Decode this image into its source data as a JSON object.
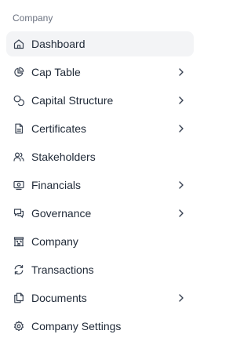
{
  "sidebar": {
    "section_label": "Company",
    "items": [
      {
        "label": "Dashboard",
        "icon": "home-icon",
        "active": true,
        "has_submenu": false
      },
      {
        "label": "Cap Table",
        "icon": "pie-chart-icon",
        "active": false,
        "has_submenu": true
      },
      {
        "label": "Capital Structure",
        "icon": "coins-icon",
        "active": false,
        "has_submenu": true
      },
      {
        "label": "Certificates",
        "icon": "certificate-icon",
        "active": false,
        "has_submenu": true
      },
      {
        "label": "Stakeholders",
        "icon": "users-icon",
        "active": false,
        "has_submenu": false
      },
      {
        "label": "Financials",
        "icon": "banknote-icon",
        "active": false,
        "has_submenu": true
      },
      {
        "label": "Governance",
        "icon": "chat-bubbles-icon",
        "active": false,
        "has_submenu": true
      },
      {
        "label": "Company",
        "icon": "building-icon",
        "active": false,
        "has_submenu": false
      },
      {
        "label": "Transactions",
        "icon": "refresh-icon",
        "active": false,
        "has_submenu": false
      },
      {
        "label": "Documents",
        "icon": "documents-icon",
        "active": false,
        "has_submenu": true
      },
      {
        "label": "Company Settings",
        "icon": "gear-icon",
        "active": false,
        "has_submenu": false
      }
    ]
  },
  "colors": {
    "active_background": "#f3f4f6",
    "text": "#1f2937",
    "muted_text": "#6b7280",
    "icon": "#374151"
  }
}
